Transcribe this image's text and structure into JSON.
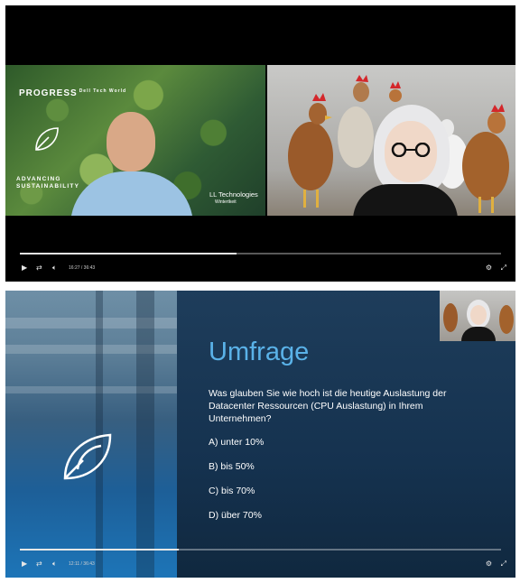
{
  "player1": {
    "left_tile": {
      "brand": "PROGRESS",
      "brand_sub": "Dell Tech World",
      "tagline_line1": "ADVANCING",
      "tagline_line2": "SUSTAINABILITY",
      "partner_logo": "LL Technologies",
      "partner_sub": "Wintertkeit"
    },
    "controls": {
      "time": "16:27 / 36:43",
      "progress": 0.45
    }
  },
  "player2": {
    "slide": {
      "title": "Umfrage",
      "question": "Was glauben Sie wie hoch ist die heutige Auslastung der Datacenter Ressourcen (CPU Auslastung) in Ihrem Unternehmen?",
      "options": [
        "A) unter 10%",
        "B) bis 50%",
        "C) bis 70%",
        "D) über 70%"
      ]
    },
    "controls": {
      "time": "12:11 / 36:43",
      "progress": 0.33
    }
  },
  "icons": {
    "play": "play-icon",
    "loop": "loop-icon",
    "volume": "volume-icon",
    "settings": "gear-icon",
    "fullscreen": "fullscreen-icon"
  }
}
